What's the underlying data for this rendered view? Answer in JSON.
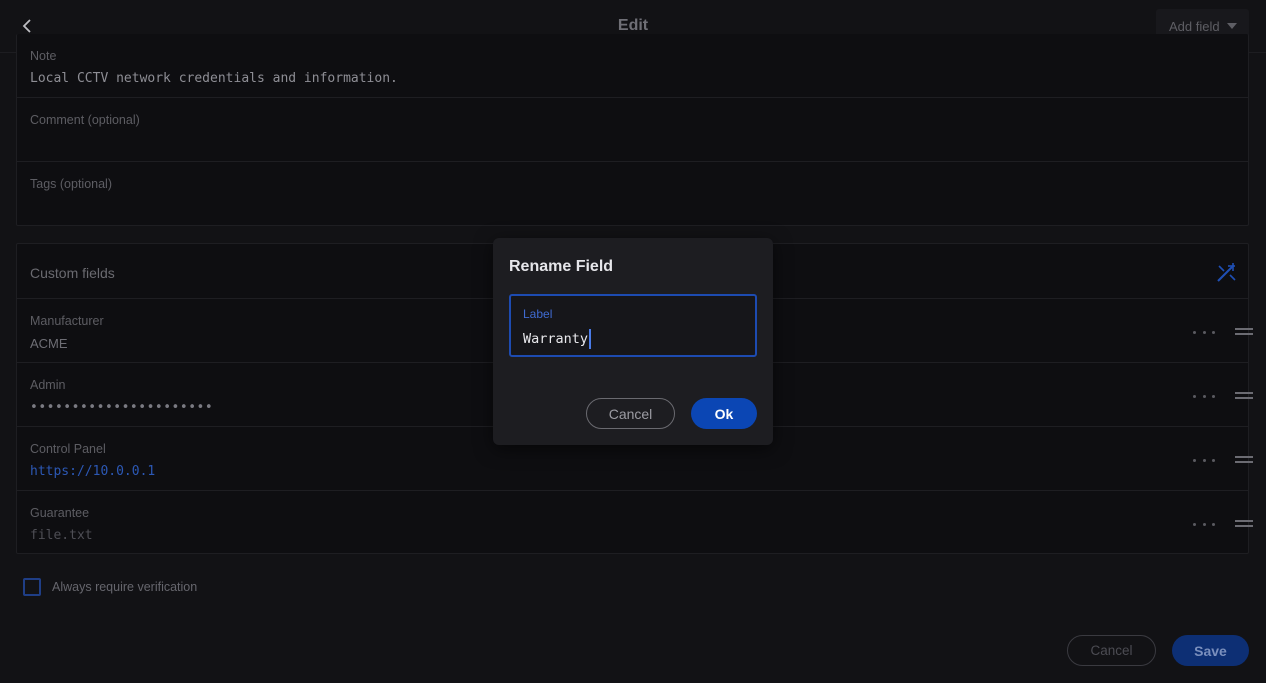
{
  "header": {
    "title": "Edit",
    "add_field_label": "Add field"
  },
  "details": [
    {
      "label": "Note",
      "value": "Local CCTV network credentials and information."
    },
    {
      "label": "Comment (optional)",
      "value": ""
    },
    {
      "label": "Tags (optional)",
      "value": ""
    }
  ],
  "custom_fields": {
    "title": "Custom fields",
    "items": [
      {
        "label": "Manufacturer",
        "value": "ACME"
      },
      {
        "label": "Admin",
        "value": "••••••••••••••••••••••"
      },
      {
        "label": "Control Panel",
        "value": "https://10.0.0.1"
      },
      {
        "label": "Guarantee",
        "value": "file.txt"
      }
    ]
  },
  "verification": {
    "label": "Always require verification",
    "checked": false
  },
  "footer": {
    "cancel_label": "Cancel",
    "save_label": "Save"
  },
  "dialog": {
    "title": "Rename Field",
    "field_label": "Label",
    "field_value": "Warranty",
    "cancel_label": "Cancel",
    "ok_label": "Ok"
  },
  "colors": {
    "accent": "#0b46b4",
    "background": "#121215",
    "dialog_bg": "#1d1d21",
    "link": "#2c58b5"
  },
  "icons": {
    "back": "chevron-left-icon",
    "add_field_caret": "caret-down-icon",
    "custom_fields_tool": "wand-icon",
    "row_more": "more-horizontal-icon",
    "row_drag": "drag-handle-icon"
  }
}
